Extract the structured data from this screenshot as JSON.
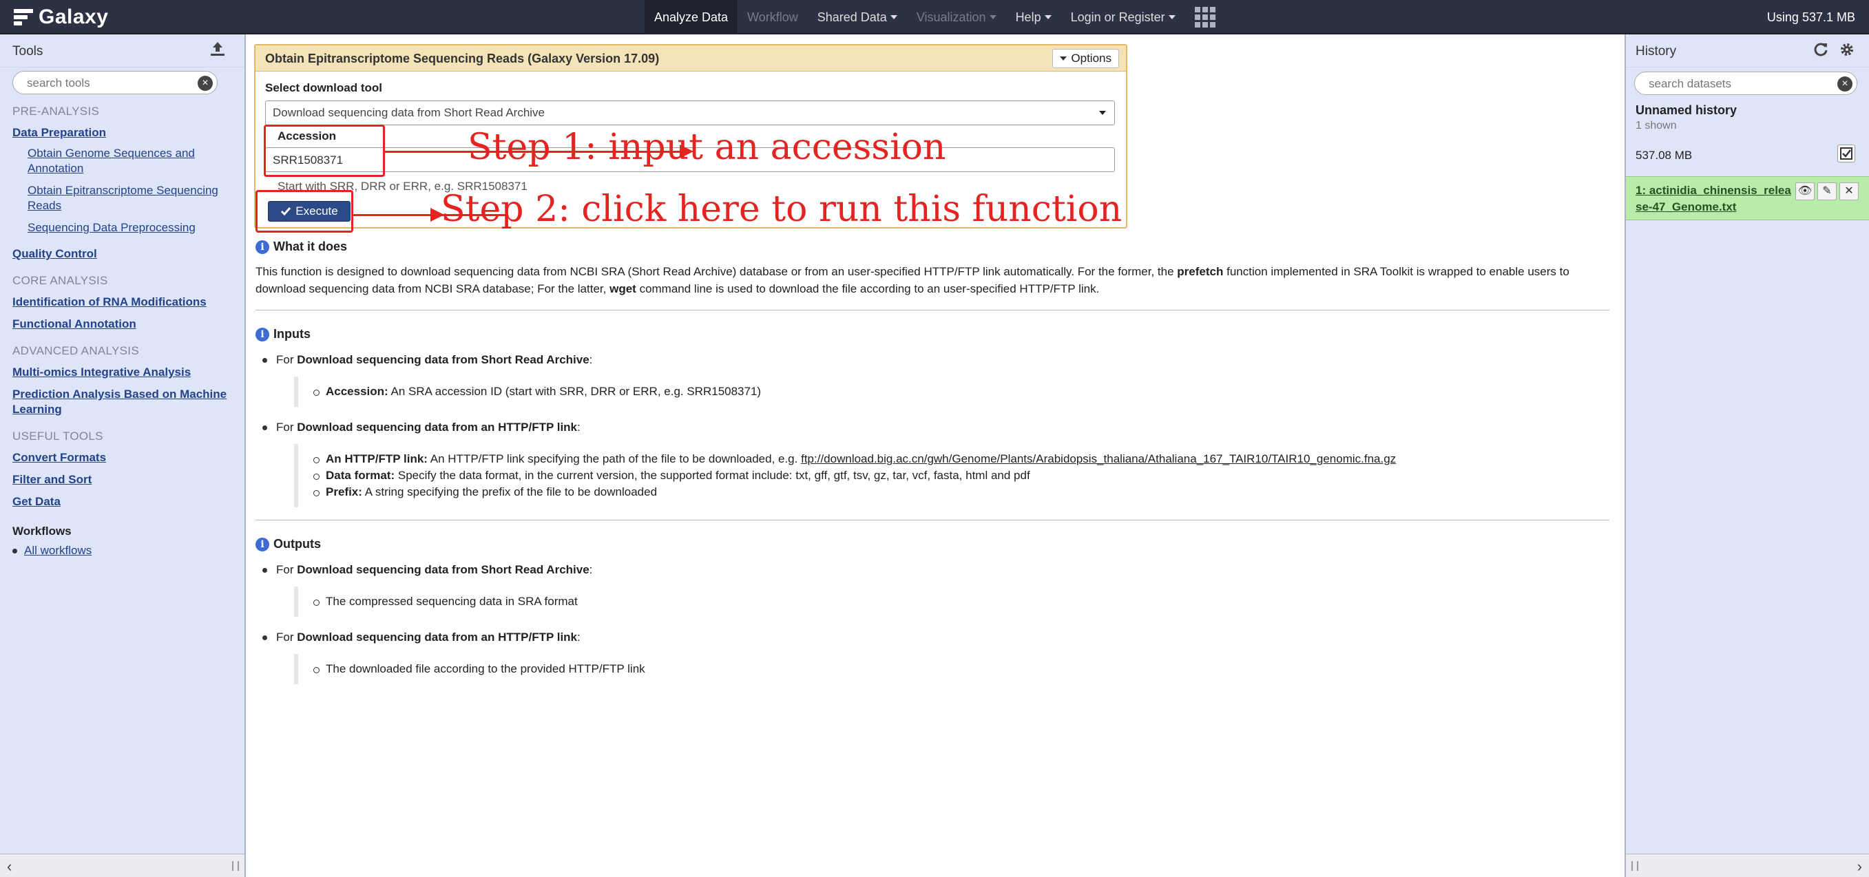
{
  "masthead": {
    "brand": "Galaxy",
    "nav": {
      "analyze": "Analyze Data",
      "workflow": "Workflow",
      "shared": "Shared Data",
      "visualization": "Visualization",
      "help": "Help",
      "login": "Login or Register"
    },
    "quota": "Using 537.1 MB"
  },
  "tools_panel": {
    "title": "Tools",
    "search_placeholder": "search tools",
    "sections": {
      "pre_analysis": "PRE-ANALYSIS",
      "data_preparation": "Data Preparation",
      "obtain_genome": "Obtain Genome Sequences and Annotation",
      "obtain_reads": "Obtain Epitranscriptome Sequencing Reads",
      "preprocessing": "Sequencing Data Preprocessing",
      "quality_control": "Quality Control",
      "core_analysis": "CORE ANALYSIS",
      "rna_mod": "Identification of RNA Modifications",
      "functional": "Functional Annotation",
      "advanced_analysis": "ADVANCED ANALYSIS",
      "multi_omics": "Multi-omics Integrative Analysis",
      "prediction": "Prediction Analysis Based on Machine Learning",
      "useful_tools": "USEFUL TOOLS",
      "convert": "Convert Formats",
      "filter": "Filter and Sort",
      "get_data": "Get Data"
    },
    "workflows_title": "Workflows",
    "all_workflows": "All workflows"
  },
  "tool_form": {
    "title": "Obtain Epitranscriptome Sequencing Reads (Galaxy Version 17.09)",
    "options_label": "Options",
    "select_label": "Select download tool",
    "select_value": "Download sequencing data from Short Read Archive",
    "accession_label": "Accession",
    "accession_value": "SRR1508371",
    "accession_help": "Start with SRR, DRR or ERR, e.g. SRR1508371",
    "execute_label": "Execute"
  },
  "annotations": {
    "step1": "Step 1: input an accession",
    "step2": "Step 2: click here to run this function"
  },
  "help": {
    "what_title": "What it does",
    "what_p1": "This function is designed to download sequencing data from NCBI SRA (Short Read Archive) database or from an user-specified HTTP/FTP link automatically. For the former, the",
    "what_prefetch": "prefetch",
    "what_p2": "function implemented in SRA Toolkit is wrapped to enable users to download sequencing data from NCBI SRA database; For the latter,",
    "what_wget": "wget",
    "what_p3": "command line is used to download the file according to an user-specified HTTP/FTP link.",
    "inputs_title": "Inputs",
    "for": "For",
    "sra_label": "Download sequencing data from Short Read Archive",
    "http_label": "Download sequencing data from an HTTP/FTP link",
    "colon": ":",
    "acc_term": "Accession:",
    "acc_desc": "An SRA accession ID (start with SRR, DRR or ERR, e.g. SRR1508371)",
    "link_term": "An HTTP/FTP link:",
    "link_desc": "An HTTP/FTP link specifying the path of the file to be downloaded, e.g.",
    "link_url": "ftp://download.big.ac.cn/gwh/Genome/Plants/Arabidopsis_thaliana/Athaliana_167_TAIR10/TAIR10_genomic.fna.gz",
    "format_term": "Data format:",
    "format_desc": "Specify the data format, in the current version, the supported format include: txt, gff, gtf, tsv, gz, tar, vcf, fasta, html and pdf",
    "prefix_term": "Prefix:",
    "prefix_desc": "A string specifying the prefix of the file to be downloaded",
    "outputs_title": "Outputs",
    "out_sra": "The compressed sequencing data in SRA format",
    "out_http": "The downloaded file according to the provided HTTP/FTP link"
  },
  "history_panel": {
    "title": "History",
    "search_placeholder": "search datasets",
    "name": "Unnamed history",
    "shown": "1 shown",
    "size": "537.08 MB",
    "dataset": "1: actinidia_chinensis_release-47_Genome.txt"
  },
  "colors": {
    "masthead": "#2c3143",
    "panel_bg": "#dfe5f9",
    "form_border": "#e5b869",
    "execute": "#2c4a86",
    "annotation": "#e52421",
    "dataset_ok": "#b9ecab"
  }
}
